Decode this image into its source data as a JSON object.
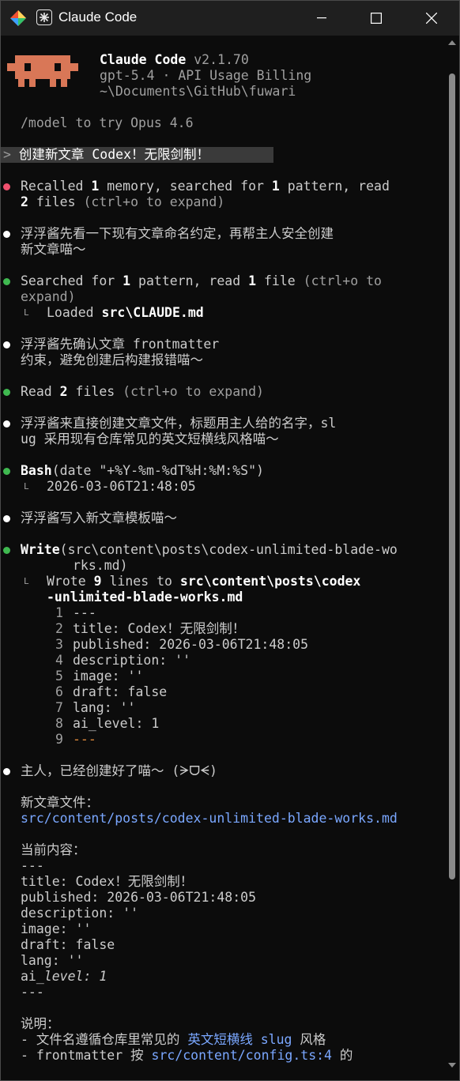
{
  "window": {
    "title": "Claude Code",
    "colors": {
      "success": "#3fb950",
      "error": "#f0506e",
      "info": "#ffffff",
      "link": "#7aa7ff",
      "mascot": "#d97757",
      "accent": "#e08a3c"
    }
  },
  "header": {
    "app_name": "Claude Code",
    "version": " v2.1.70",
    "model_line": "gpt-5.4 · API Usage Billing",
    "path_line": "~\\Documents\\GitHub\\fuwari",
    "tip": "/model to try Opus 4.6"
  },
  "prompt": {
    "symbol": ">",
    "text": " 创建新文章 Codex！无限剑制！"
  },
  "entries": {
    "recall": {
      "p1": "Recalled ",
      "n1": "1",
      "p2": " memory, searched for ",
      "n2": "1",
      "p3": " pattern, read",
      "n3": "2",
      "p4": " files ",
      "hint": "(ctrl+o to expand)"
    },
    "msg1": {
      "l1": "浮浮酱先看一下现有文章命名约定，再帮主人安全创建",
      "l2": "新文章喵～"
    },
    "search": {
      "p1": "Searched for ",
      "n1": "1",
      "p2": " pattern, read ",
      "n2": "1",
      "p3": " file ",
      "hint1": "(ctrl+o to",
      "hint2": "expand)",
      "loaded_prefix": "Loaded ",
      "loaded_file": "src\\CLAUDE.md"
    },
    "msg2": {
      "l1": "浮浮酱先确认文章 frontmatter",
      "l2": "约束，避免创建后构建报错喵～"
    },
    "read": {
      "p1": "Read ",
      "n1": "2",
      "p2": " files ",
      "hint": "(ctrl+o to expand)"
    },
    "msg3": {
      "l1": "浮浮酱来直接创建文章文件，标题用主人给的名字，sl",
      "l2": "ug 采用现有仓库常见的英文短横线风格喵～"
    },
    "bash": {
      "tool": "Bash",
      "args": "(date \"+%Y-%m-%dT%H:%M:%S\")",
      "output": "2026-03-06T21:48:05"
    },
    "msg4": {
      "l1": "浮浮酱写入新文章模板喵～"
    },
    "write": {
      "tool": "Write",
      "args1": "(src\\content\\posts\\codex-unlimited-blade-wo",
      "args2": "rks.md)",
      "result_prefix": "Wrote ",
      "n": "9",
      "result_mid": " lines to ",
      "path1": "src\\content\\posts\\codex",
      "path2": "-unlimited-blade-works.md"
    },
    "code_lines": [
      {
        "num": "1",
        "text": "---"
      },
      {
        "num": "2",
        "text": "title: Codex！无限剑制！"
      },
      {
        "num": "3",
        "text": "published: 2026-03-06T21:48:05"
      },
      {
        "num": "4",
        "text": "description: ''"
      },
      {
        "num": "5",
        "text": "image: ''"
      },
      {
        "num": "6",
        "text": "draft: false"
      },
      {
        "num": "7",
        "text": "lang: ''"
      },
      {
        "num": "8",
        "text": "ai_level: 1"
      },
      {
        "num": "9",
        "text": "---"
      }
    ],
    "final": {
      "l1": "主人，已经创建好了喵～ (ᗒᗜᗕ)",
      "file_label": "新文章文件：",
      "file_path": "src/content/posts/codex-unlimited-blade-works.md",
      "content_label": "当前内容：",
      "c1": "---",
      "c2": "title: Codex！无限剑制！",
      "c3": "published: 2026-03-06T21:48:05",
      "c4": "description: ''",
      "c5": "image: ''",
      "c6": "draft: false",
      "c7": "lang: ''",
      "c8a": "ai_",
      "c8b": "level: 1",
      "c9": "---",
      "notes_label": "说明：",
      "n1a": "- 文件名遵循仓库里常见的 ",
      "n1b": "英文短横线 slug",
      "n1c": " 风格",
      "n2a": "- frontmatter 按 ",
      "n2b": "src/content/config.ts:4",
      "n2c": " 的"
    }
  }
}
